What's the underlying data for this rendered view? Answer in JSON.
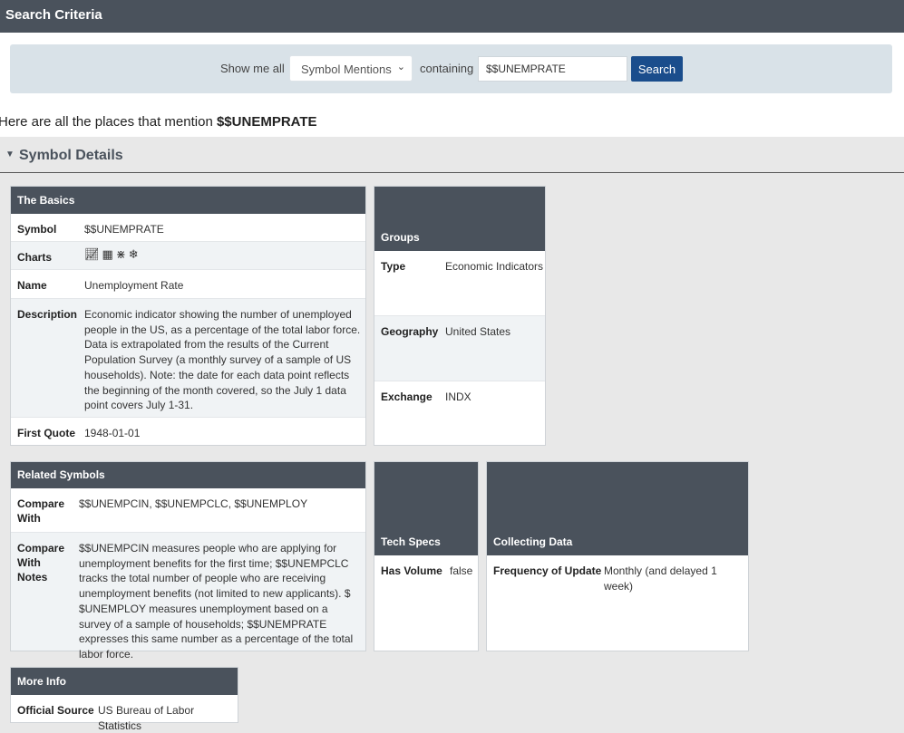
{
  "header": {
    "title": "Search Criteria"
  },
  "search": {
    "show_label": "Show me all",
    "selected": "Symbol Mentions",
    "containing_label": "containing",
    "value": "$$UNEMPRATE",
    "button": "Search"
  },
  "results": {
    "prefix": "Here are all the places that mention ",
    "symbol": "$$UNEMPRATE"
  },
  "section": {
    "title": "Symbol Details"
  },
  "basics": {
    "title": "The Basics",
    "symbol_label": "Symbol",
    "symbol": "$$UNEMPRATE",
    "charts_label": "Charts",
    "chart_icons": [
      "line-chart-icon",
      "area-chart-icon",
      "seasonality-icon",
      "snowflake-icon"
    ],
    "name_label": "Name",
    "name": "Unemployment Rate",
    "description_label": "Description",
    "description": "Economic indicator showing the number of unemployed people in the US, as a percentage of the total labor force. Data is extrapolated from the results of the Current Population Survey (a monthly survey of a sample of US households). Note: the date for each data point reflects the beginning of the month covered, so the July 1 data point covers July 1-31.",
    "first_quote_label": "First Quote",
    "first_quote": "1948-01-01"
  },
  "groups": {
    "title": "Groups",
    "type_label": "Type",
    "type": "Economic Indicators",
    "geography_label": "Geography",
    "geography": "United States",
    "exchange_label": "Exchange",
    "exchange": "INDX"
  },
  "related": {
    "title": "Related Symbols",
    "compare_label": "Compare With",
    "compare": "$$UNEMPCIN, $$UNEMPCLC, $$UNEMPLOY",
    "notes_label": "Compare With Notes",
    "notes": "$$UNEMPCIN measures people who are applying for unemployment benefits for the first time; $$UNEMPCLC tracks the total number of people who are receiving unemployment benefits (not limited to new applicants). $ $UNEMPLOY measures unemployment based on a survey of a sample of households; $$UNEMPRATE expresses this same number as a percentage of the total labor force."
  },
  "tech": {
    "title": "Tech Specs",
    "volume_label": "Has Volume",
    "volume": "false"
  },
  "collecting": {
    "title": "Collecting Data",
    "freq_label": "Frequency of Update",
    "freq": "Monthly (and delayed 1 week)"
  },
  "more": {
    "title": "More Info",
    "source_label": "Official Source",
    "source": "US Bureau of Labor Statistics"
  }
}
